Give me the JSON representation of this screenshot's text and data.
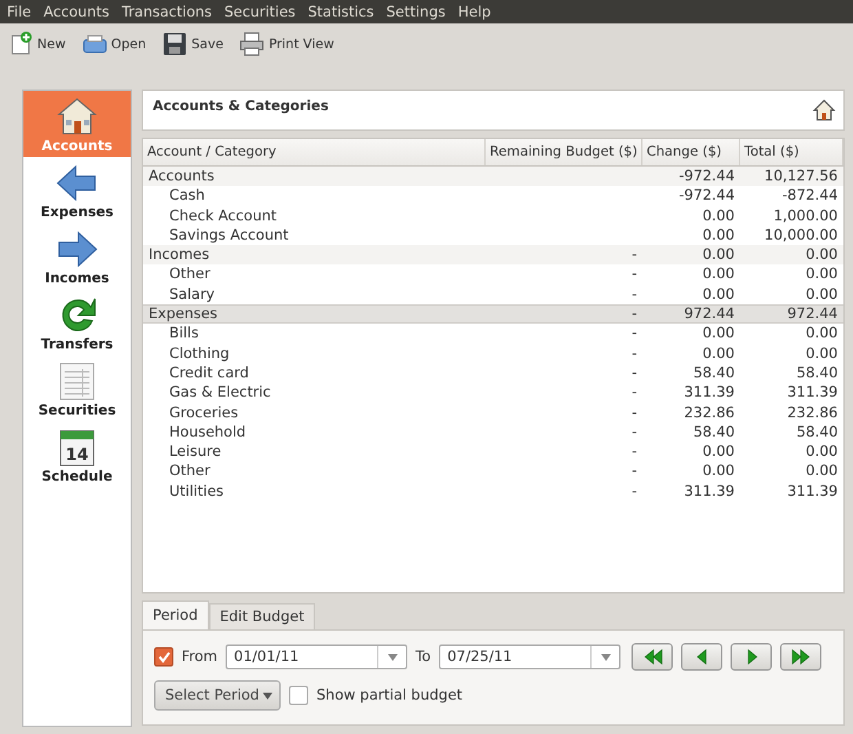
{
  "menu": [
    "File",
    "Accounts",
    "Transactions",
    "Securities",
    "Statistics",
    "Settings",
    "Help"
  ],
  "toolbar": [
    "New",
    "Open",
    "Save",
    "Print View"
  ],
  "sidebar": {
    "items": [
      {
        "label": "Accounts",
        "selected": true
      },
      {
        "label": "Expenses",
        "selected": false
      },
      {
        "label": "Incomes",
        "selected": false
      },
      {
        "label": "Transfers",
        "selected": false
      },
      {
        "label": "Securities",
        "selected": false
      },
      {
        "label": "Schedule",
        "selected": false,
        "icon_label": "14"
      }
    ]
  },
  "header": {
    "title": "Accounts & Categories"
  },
  "table": {
    "columns": [
      "Account / Category",
      "Remaining Budget ($)",
      "Change ($)",
      "Total ($)"
    ],
    "rows": [
      {
        "name": "Accounts",
        "change": "-972.44",
        "total": "10,127.56",
        "selected": false,
        "children": [
          {
            "name": "Cash",
            "change": "-972.44",
            "total": "-872.44"
          },
          {
            "name": "Check Account",
            "change": "0.00",
            "total": "1,000.00"
          },
          {
            "name": "Savings Account",
            "change": "0.00",
            "total": "10,000.00"
          }
        ]
      },
      {
        "name": "Incomes",
        "budget": "-",
        "change": "0.00",
        "total": "0.00",
        "selected": false,
        "children": [
          {
            "name": "Other",
            "budget": "-",
            "change": "0.00",
            "total": "0.00"
          },
          {
            "name": "Salary",
            "budget": "-",
            "change": "0.00",
            "total": "0.00"
          }
        ]
      },
      {
        "name": "Expenses",
        "budget": "-",
        "change": "972.44",
        "total": "972.44",
        "selected": true,
        "children": [
          {
            "name": "Bills",
            "budget": "-",
            "change": "0.00",
            "total": "0.00"
          },
          {
            "name": "Clothing",
            "budget": "-",
            "change": "0.00",
            "total": "0.00"
          },
          {
            "name": "Credit card",
            "budget": "-",
            "change": "58.40",
            "total": "58.40"
          },
          {
            "name": "Gas & Electric",
            "budget": "-",
            "change": "311.39",
            "total": "311.39"
          },
          {
            "name": "Groceries",
            "budget": "-",
            "change": "232.86",
            "total": "232.86"
          },
          {
            "name": "Household",
            "budget": "-",
            "change": "58.40",
            "total": "58.40"
          },
          {
            "name": "Leisure",
            "budget": "-",
            "change": "0.00",
            "total": "0.00"
          },
          {
            "name": "Other",
            "budget": "-",
            "change": "0.00",
            "total": "0.00"
          },
          {
            "name": "Utilities",
            "budget": "-",
            "change": "311.39",
            "total": "311.39"
          }
        ]
      }
    ]
  },
  "tabs": [
    {
      "label": "Period",
      "selected": true
    },
    {
      "label": "Edit Budget",
      "selected": false
    }
  ],
  "period": {
    "from_checked": true,
    "from_label": "From",
    "from_value": "01/01/11",
    "to_label": "To",
    "to_value": "07/25/11",
    "select_button": "Select Period",
    "partial": {
      "label": "Show partial budget",
      "checked": false
    }
  }
}
